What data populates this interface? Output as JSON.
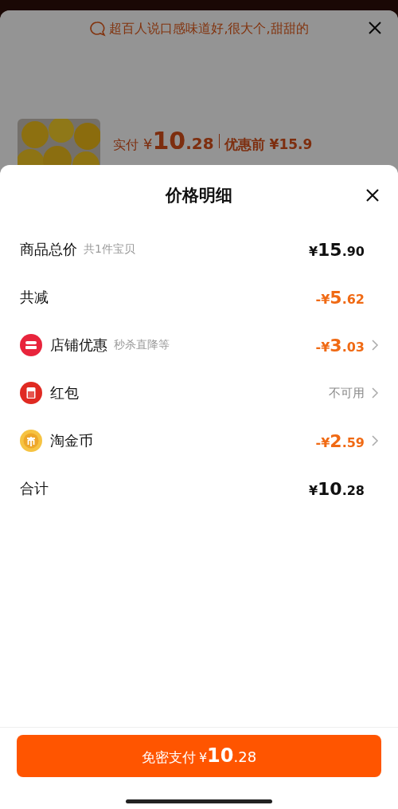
{
  "background": {
    "review_banner": "超百人说口感味道好,很大个,甜甜的",
    "product": {
      "kind": "picture",
      "paid_label": "实付",
      "paid_price": "¥10.28",
      "before_label": "优惠前 ¥15.9"
    }
  },
  "sheet": {
    "title": "价格明细",
    "rows": [
      {
        "kind": "summary",
        "label": "商品总价",
        "note": "共1件宝贝",
        "value": "¥15.90",
        "color": "#111111"
      },
      {
        "kind": "summary",
        "label": "共减",
        "value": "-¥5.62",
        "color": "#f06a14"
      },
      {
        "kind": "entry",
        "label": "店铺优惠",
        "note": "秒杀直降等",
        "value": "-¥3.03",
        "color": "#f06a14"
      },
      {
        "kind": "entry",
        "label": "红包",
        "value": "不可用",
        "color": "#888888"
      },
      {
        "kind": "entry",
        "label": "淘金币",
        "value": "-¥2.59",
        "color": "#f06a14"
      },
      {
        "kind": "summary",
        "label": "合计",
        "value": "¥10.28",
        "color": "#111111"
      }
    ],
    "pay_button": {
      "label": "免密支付",
      "amount": "¥10.28"
    }
  }
}
